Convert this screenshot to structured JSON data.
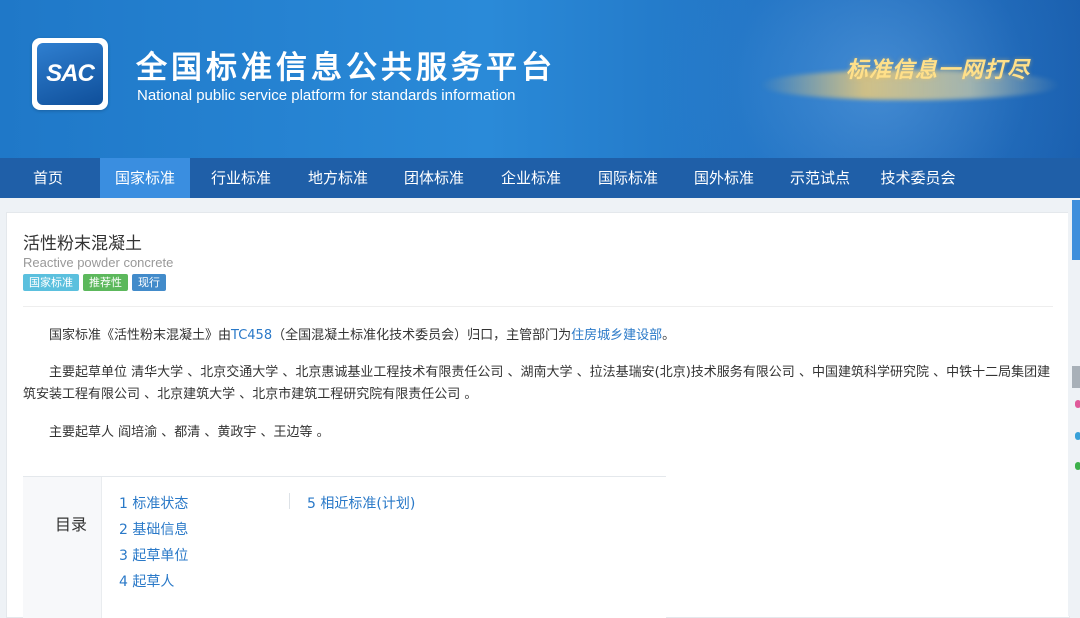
{
  "header": {
    "logo_text": "SAC",
    "title_cn": "全国标准信息公共服务平台",
    "title_en": "National public service platform  for standards information",
    "slogan": "标准信息一网打尽"
  },
  "nav": {
    "items": [
      {
        "label": "首页"
      },
      {
        "label": "国家标准"
      },
      {
        "label": "行业标准"
      },
      {
        "label": "地方标准"
      },
      {
        "label": "团体标准"
      },
      {
        "label": "企业标准"
      },
      {
        "label": "国际标准"
      },
      {
        "label": "国外标准"
      },
      {
        "label": "示范试点"
      },
      {
        "label": "技术委员会"
      }
    ],
    "active_index": 1
  },
  "standard": {
    "title": "活性粉末混凝土",
    "title_en": "Reactive powder concrete",
    "tags": [
      "国家标准",
      "推荐性",
      "现行"
    ],
    "intro": {
      "prefix": "国家标准《活性粉末混凝土》由",
      "tc_link": "TC458",
      "middle": "（全国混凝土标准化技术委员会）归口，主管部门为",
      "dept_link": "住房城乡建设部",
      "suffix": "。"
    },
    "drafting_units": "主要起草单位 清华大学 、北京交通大学 、北京惠诚基业工程技术有限责任公司 、湖南大学 、拉法基瑞安(北京)技术服务有限公司 、中国建筑科学研究院 、中铁十二局集团建筑安装工程有限公司 、北京建筑大学 、北京市建筑工程研究院有限责任公司 。",
    "drafters": "主要起草人 阎培渝 、都清 、黄政宇 、王边等 。"
  },
  "toc": {
    "label": "目录",
    "items": [
      "1  标准状态",
      "2  基础信息",
      "3  起草单位",
      "4  起草人",
      "5  相近标准(计划)"
    ]
  }
}
